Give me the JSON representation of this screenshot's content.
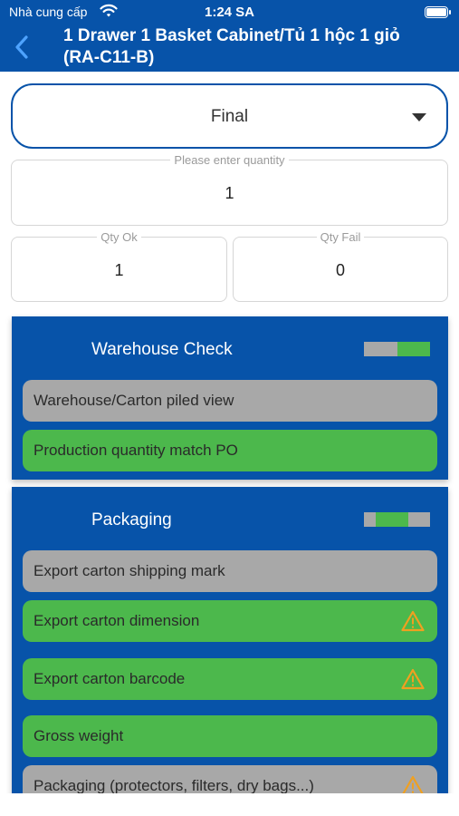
{
  "status_bar": {
    "carrier": "Nhà cung cấp",
    "time": "1:24 SA"
  },
  "header": {
    "title_line1": "1 Drawer 1 Basket Cabinet/Tủ 1 hộc 1 giỏ",
    "title_line2": "(RA-C11-B)"
  },
  "stage_select": {
    "value": "Final"
  },
  "quantity": {
    "label": "Please enter quantity",
    "value": "1"
  },
  "qty_ok": {
    "label": "Qty Ok",
    "value": "1"
  },
  "qty_fail": {
    "label": "Qty Fail",
    "value": "0"
  },
  "colors": {
    "brand_blue": "#0753a9",
    "pass_green": "#4cb84c",
    "pending_gray": "#a8a8a8",
    "warning_orange": "#f0a020"
  },
  "sections": [
    {
      "title": "Warehouse Check",
      "items": [
        {
          "label": "Warehouse/Carton piled view",
          "status": "gray",
          "warning": false
        },
        {
          "label": "Production quantity match PO",
          "status": "green",
          "warning": false
        }
      ]
    },
    {
      "title": "Packaging",
      "items": [
        {
          "label": "Export carton shipping mark",
          "status": "gray",
          "warning": false
        },
        {
          "label": "Export carton dimension",
          "status": "green",
          "warning": true
        },
        {
          "label": "Export carton barcode",
          "status": "green",
          "warning": true
        },
        {
          "label": "Gross weight",
          "status": "green",
          "warning": false
        },
        {
          "label": "Packaging (protectors, filters, dry bags...)",
          "status": "gray",
          "warning": true
        }
      ]
    }
  ]
}
